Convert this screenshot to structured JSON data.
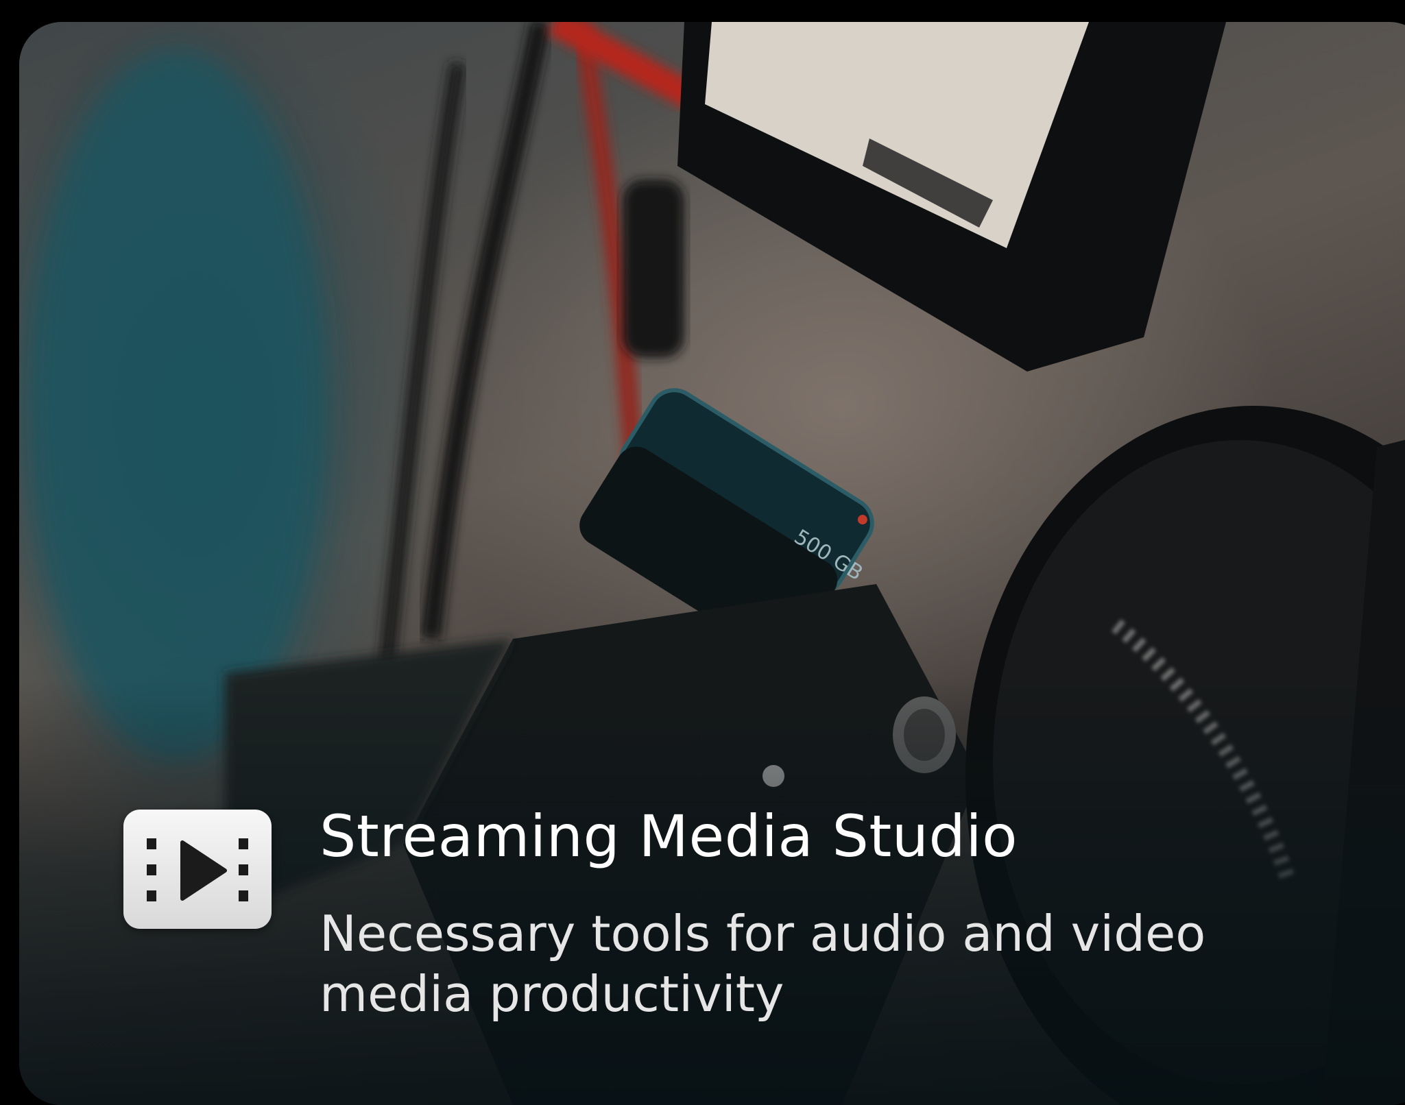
{
  "card": {
    "title": "Streaming Media Studio",
    "subtitle": "Necessary tools for audio and video media productivity",
    "icon": "film-play-icon"
  },
  "background": {
    "storage_label": "500 GB"
  },
  "colors": {
    "title_text": "#ffffff",
    "subtitle_text": "#e6e6e6",
    "icon_bg": "#eeeeee",
    "icon_glyph": "#1b1b1b",
    "accent_red": "#b4251c"
  }
}
